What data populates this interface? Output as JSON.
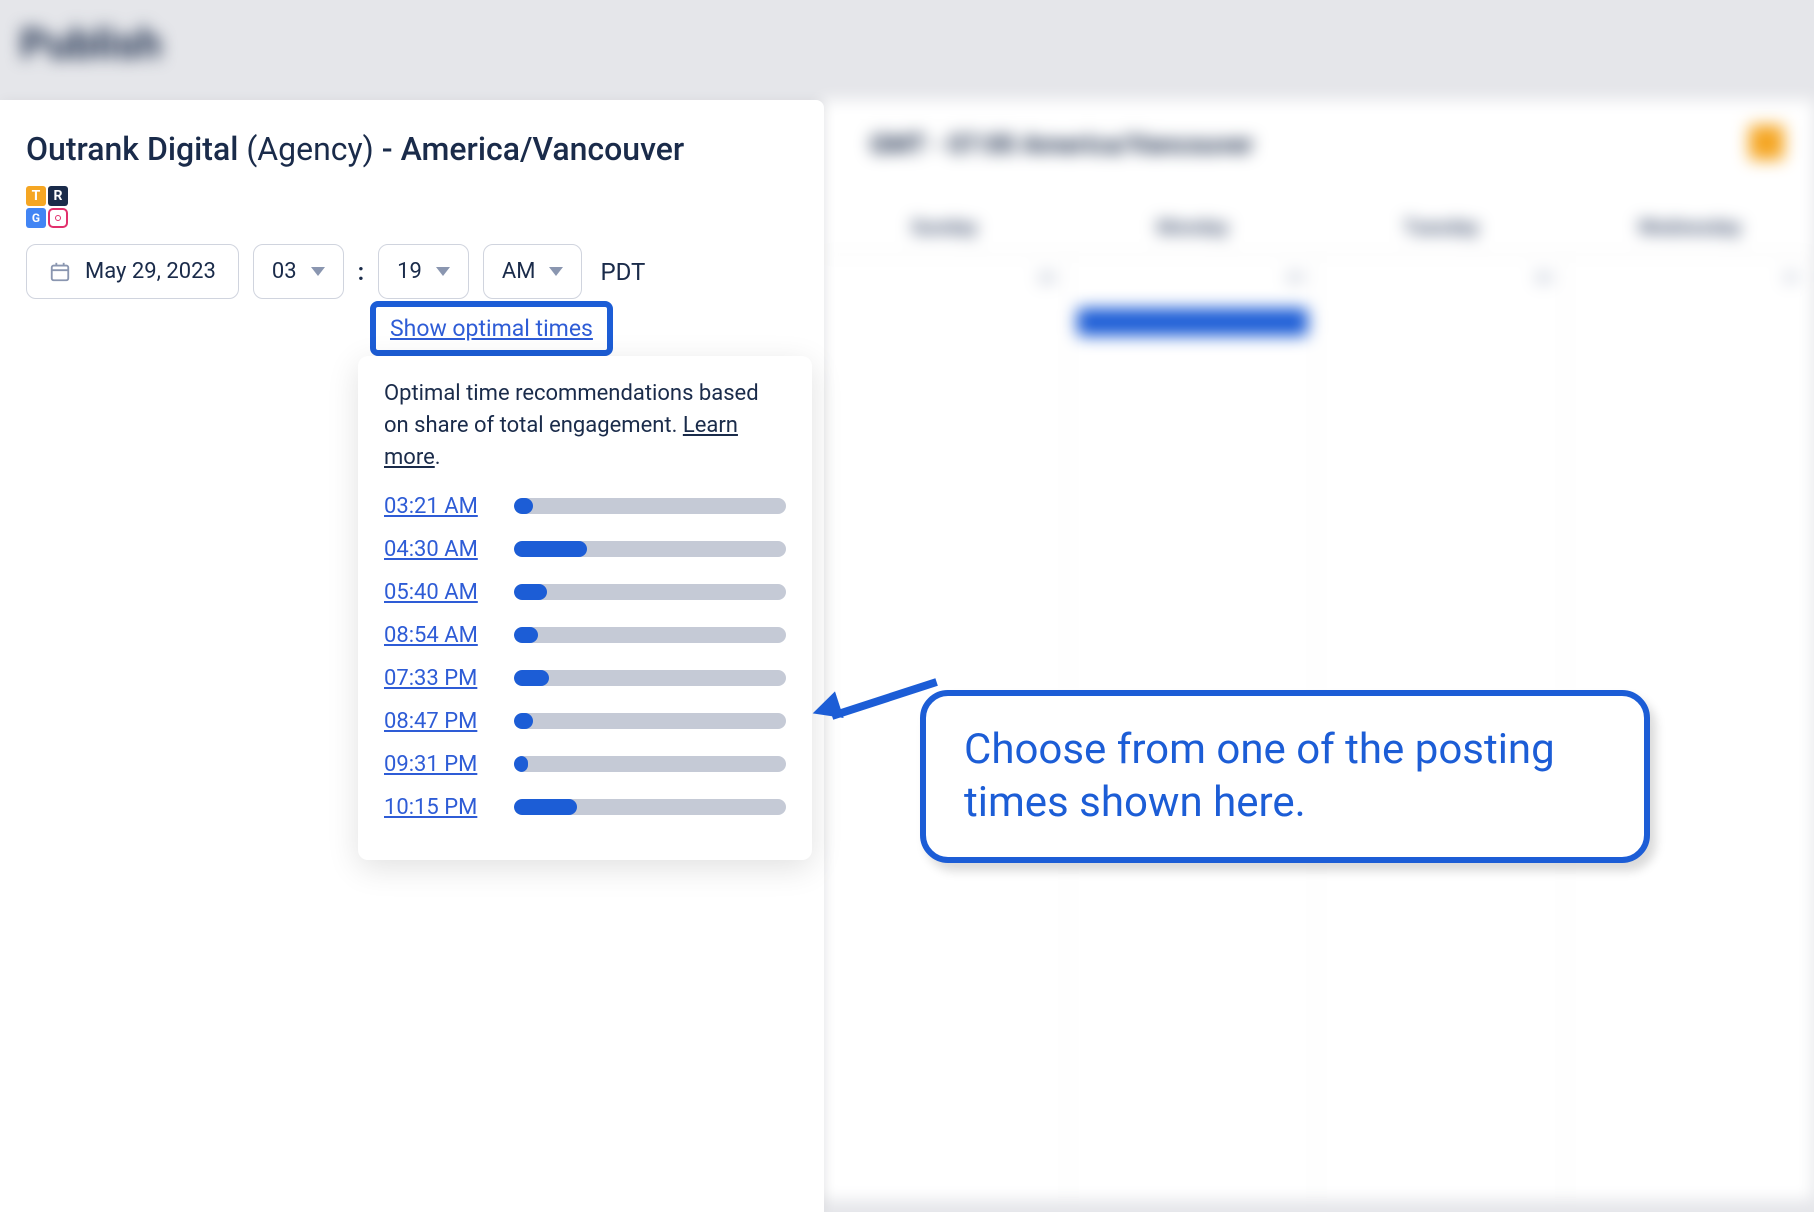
{
  "header": {
    "title": "Publish"
  },
  "background_calendar": {
    "title": "GMT - 07:00 America/Vancouver",
    "days": [
      "Sunday",
      "Monday",
      "Tuesday",
      "Wednesday"
    ],
    "dates": [
      "28",
      "29",
      "30",
      "31"
    ]
  },
  "panel": {
    "title_prefix": "Outrank Digital ",
    "title_paren": "(Agency)",
    "title_suffix": " - America/Vancouver",
    "avatar_labels": {
      "t": "T",
      "r": "R",
      "g": "G"
    },
    "date": "May 29, 2023",
    "hour": "03",
    "minute": "19",
    "ampm": "AM",
    "tz": "PDT",
    "show_optimal": "Show optimal times"
  },
  "popover": {
    "text_prefix": "Optimal time recommendations based on share of total engagement. ",
    "learn_more": "Learn more",
    "text_suffix": ".",
    "times": [
      {
        "label": "03:21 AM",
        "pct": 7
      },
      {
        "label": "04:30 AM",
        "pct": 27
      },
      {
        "label": "05:40 AM",
        "pct": 12
      },
      {
        "label": "08:54 AM",
        "pct": 9
      },
      {
        "label": "07:33 PM",
        "pct": 13
      },
      {
        "label": "08:47 PM",
        "pct": 7
      },
      {
        "label": "09:31 PM",
        "pct": 5
      },
      {
        "label": "10:15 PM",
        "pct": 23
      }
    ]
  },
  "callout": {
    "text": "Choose from one of the posting times shown here."
  }
}
